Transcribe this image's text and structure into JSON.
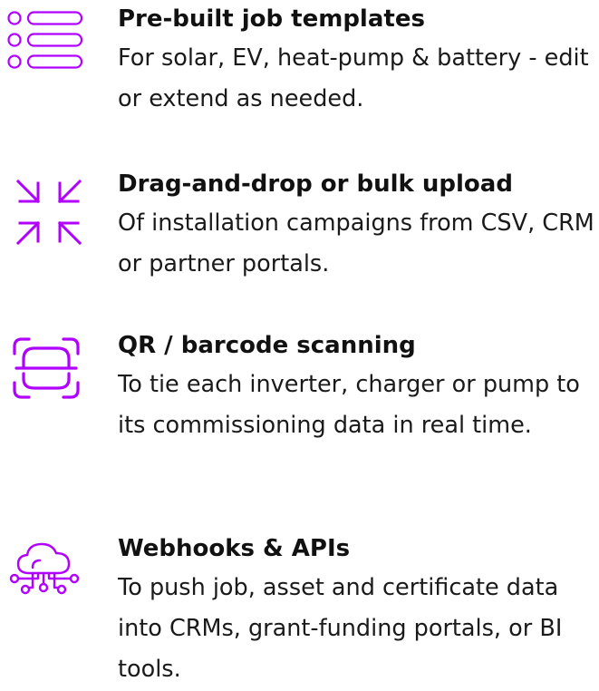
{
  "accent_color": "#b000ff",
  "features": [
    {
      "icon": "list-icon",
      "title": "Pre-built job templates",
      "description": "For solar, EV, heat-pump & battery - edit or extend as needed."
    },
    {
      "icon": "collapse-arrows-icon",
      "title": "Drag-and-drop or bulk upload",
      "description": "Of installation campaigns from CSV, CRM or partner portals."
    },
    {
      "icon": "scan-icon",
      "title": "QR / barcode scanning",
      "description": "To tie each inverter, charger or pump to its commissioning data in real time."
    },
    {
      "icon": "cloud-network-icon",
      "title": "Webhooks & APIs",
      "description": "To push job, asset and certificate data into CRMs, grant-funding portals, or BI tools."
    }
  ]
}
